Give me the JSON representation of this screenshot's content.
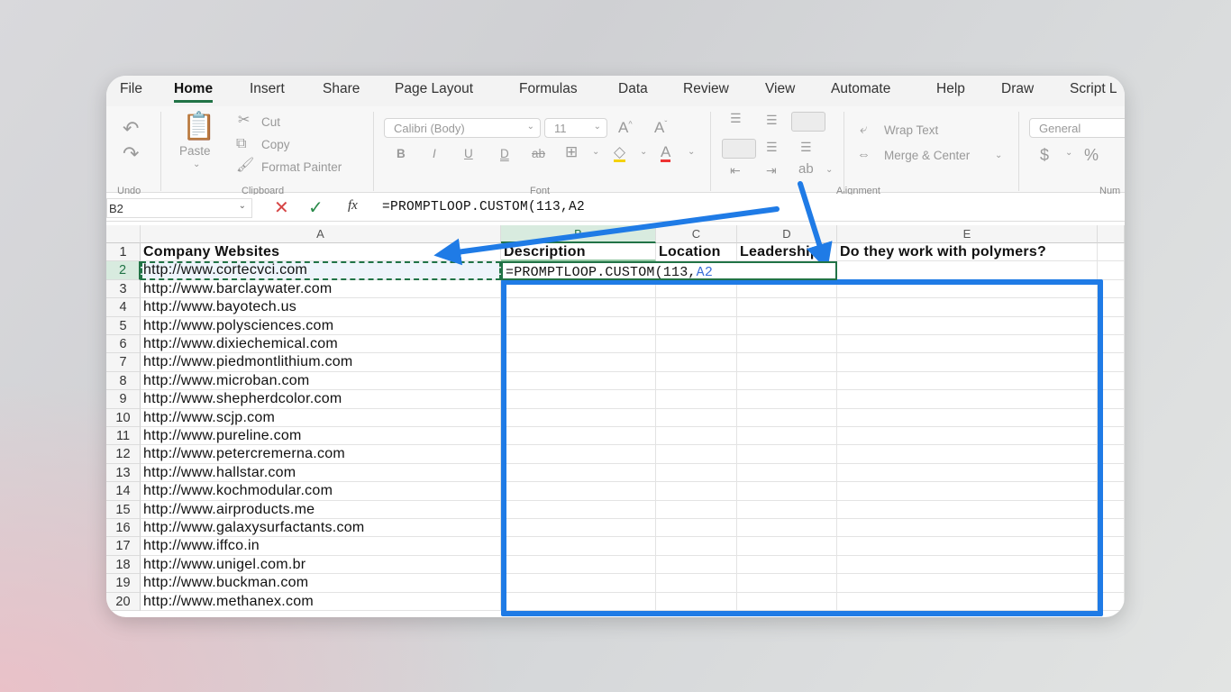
{
  "menu": [
    "File",
    "Home",
    "Insert",
    "Share",
    "Page Layout",
    "Formulas",
    "Data",
    "Review",
    "View",
    "Automate",
    "Help",
    "Draw",
    "Script L"
  ],
  "ribbon": {
    "undo_group": "Undo",
    "paste": "Paste",
    "cut": "Cut",
    "copy": "Copy",
    "format_painter": "Format Painter",
    "clipboard_group": "Clipboard",
    "font_name": "Calibri (Body)",
    "font_size": "11",
    "font_group": "Font",
    "bold": "B",
    "italic": "I",
    "underline": "U",
    "double_underline": "D",
    "strikethrough": "ab",
    "wrap_text": "Wrap Text",
    "merge_center": "Merge & Center",
    "alignment_group": "Alignment",
    "number_format": "General",
    "currency": "$",
    "percent": "%",
    "number_group": "Num"
  },
  "formula_bar": {
    "name_box": "B2",
    "fx": "fx",
    "formula": "=PROMPTLOOP.CUSTOM(113,A2"
  },
  "columns": [
    "A",
    "B",
    "C",
    "D",
    "E"
  ],
  "headers": {
    "A": "Company Websites",
    "B": "Description",
    "C": "Location",
    "D": "Leadership",
    "E": "Do they work with polymers?"
  },
  "active_cell": {
    "text": "=PROMPTLOOP.CUSTOM(113,",
    "ref": "A2"
  },
  "rows": [
    {
      "num": "1"
    },
    {
      "num": "2",
      "a": "http://www.cortecvci.com"
    },
    {
      "num": "3",
      "a": "http://www.barclaywater.com"
    },
    {
      "num": "4",
      "a": "http://www.bayotech.us"
    },
    {
      "num": "5",
      "a": "http://www.polysciences.com"
    },
    {
      "num": "6",
      "a": "http://www.dixiechemical.com"
    },
    {
      "num": "7",
      "a": "http://www.piedmontlithium.com"
    },
    {
      "num": "8",
      "a": "http://www.microban.com"
    },
    {
      "num": "9",
      "a": "http://www.shepherdcolor.com"
    },
    {
      "num": "10",
      "a": "http://www.scjp.com"
    },
    {
      "num": "11",
      "a": "http://www.pureline.com"
    },
    {
      "num": "12",
      "a": "http://www.petercremerna.com"
    },
    {
      "num": "13",
      "a": "http://www.hallstar.com"
    },
    {
      "num": "14",
      "a": "http://www.kochmodular.com"
    },
    {
      "num": "15",
      "a": "http://www.airproducts.me"
    },
    {
      "num": "16",
      "a": "http://www.galaxysurfactants.com"
    },
    {
      "num": "17",
      "a": "http://www.iffco.in"
    },
    {
      "num": "18",
      "a": "http://www.unigel.com.br"
    },
    {
      "num": "19",
      "a": "http://www.buckman.com"
    },
    {
      "num": "20",
      "a": "http://www.methanex.com"
    }
  ],
  "colors": {
    "accent": "#217346",
    "highlight": "#1f7be6",
    "reference": "#3a6fd8"
  }
}
